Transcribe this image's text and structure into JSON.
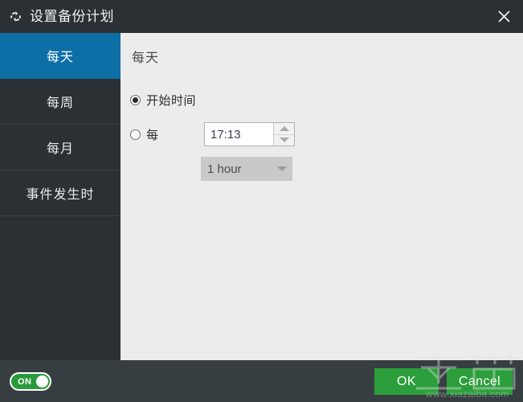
{
  "window": {
    "title": "设置备份计划",
    "title_icon": "sync-cycle-icon",
    "close_icon": "close-icon",
    "accent_blue": "#0e6ea6",
    "chrome_dark": "#2b3034",
    "footer_dark": "#373e42",
    "panel_bg": "#ececec",
    "green": "#2c9f3c"
  },
  "sidebar": {
    "items": [
      {
        "label": "每天",
        "active": true
      },
      {
        "label": "每周",
        "active": false
      },
      {
        "label": "每月",
        "active": false
      },
      {
        "label": "事件发生时",
        "active": false
      }
    ]
  },
  "content": {
    "heading": "每天",
    "options": [
      {
        "label": "开始时间",
        "selected": true,
        "control": "time-spinner",
        "value": "17:13"
      },
      {
        "label": "每",
        "selected": false,
        "control": "interval-select",
        "value": "1 hour",
        "disabled": true
      }
    ]
  },
  "footer": {
    "toggle": {
      "label": "ON",
      "state": "on"
    },
    "ok_label": "OK",
    "cancel_label": "Cancel"
  },
  "watermark": {
    "logo_text": "下载吧",
    "url_text": "www.xiazaiba.com"
  }
}
